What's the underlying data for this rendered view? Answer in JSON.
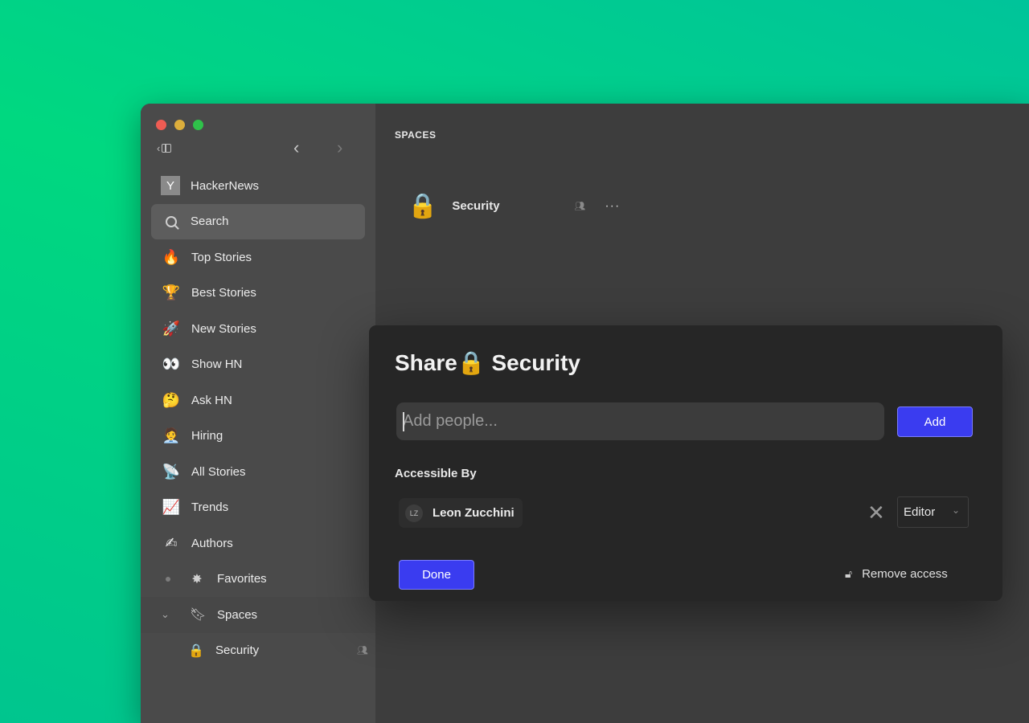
{
  "sidebar": {
    "items": [
      {
        "label": "HackerNews",
        "icon": "Y"
      },
      {
        "label": "Search",
        "icon": "search-icon"
      },
      {
        "label": "Top Stories",
        "icon": "🔥"
      },
      {
        "label": "Best Stories",
        "icon": "🏆"
      },
      {
        "label": "New Stories",
        "icon": "🚀"
      },
      {
        "label": "Show HN",
        "icon": "👀"
      },
      {
        "label": "Ask HN",
        "icon": "🤔"
      },
      {
        "label": "Hiring",
        "icon": "🧑‍💼"
      },
      {
        "label": "All Stories",
        "icon": "📡"
      },
      {
        "label": "Trends",
        "icon": "📈"
      },
      {
        "label": "Authors",
        "icon": "✍"
      }
    ],
    "favorites_label": "Favorites",
    "spaces_label": "Spaces",
    "spaces_items": [
      {
        "label": "Security",
        "icon": "🔒"
      }
    ]
  },
  "main": {
    "heading": "SPACES",
    "space": {
      "name": "Security",
      "icon": "🔒",
      "more": "···"
    }
  },
  "modal": {
    "title_prefix": "Share",
    "title_icon": "🔒",
    "title_name": "Security",
    "input_placeholder": "Add people...",
    "add_label": "Add",
    "accessible_label": "Accessible By",
    "user": {
      "initials": "LZ",
      "name": "Leon Zucchini"
    },
    "role": "Editor",
    "done_label": "Done",
    "remove_access_label": "Remove access"
  },
  "colors": {
    "accent": "#3a3cf0",
    "window": "#3d3d3d",
    "sidebar": "#4a4a4a",
    "modal": "#262626"
  }
}
